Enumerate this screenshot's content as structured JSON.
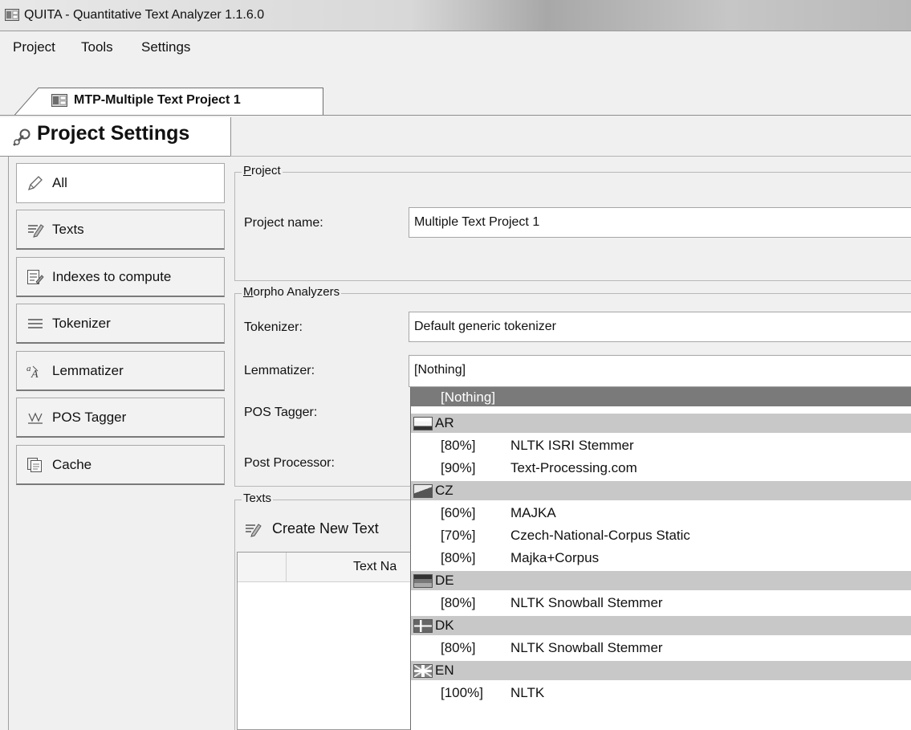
{
  "window": {
    "title": "QUITA - Quantitative Text Analyzer 1.1.6.0"
  },
  "menu": {
    "items": [
      "Project",
      "Tools",
      "Settings"
    ]
  },
  "document_tab": {
    "label": "MTP-Multiple Text Project 1"
  },
  "settings": {
    "title": "Project Settings"
  },
  "sidebar": {
    "items": [
      {
        "label": "All",
        "icon": "pencil-icon"
      },
      {
        "label": "Texts",
        "icon": "text-icon"
      },
      {
        "label": "Indexes to compute",
        "icon": "indexes-icon"
      },
      {
        "label": "Tokenizer",
        "icon": "tokenizer-icon"
      },
      {
        "label": "Lemmatizer",
        "icon": "lemmatizer-icon"
      },
      {
        "label": "POS Tagger",
        "icon": "pos-tagger-icon"
      },
      {
        "label": "Cache",
        "icon": "cache-icon"
      }
    ],
    "active_index": 0
  },
  "project_group": {
    "label": "Project",
    "name_label": "Project name:",
    "name_value": "Multiple Text Project 1"
  },
  "morpho_group": {
    "label": "Morpho Analyzers",
    "tokenizer_label": "Tokenizer:",
    "tokenizer_value": "Default generic tokenizer",
    "lemmatizer_label": "Lemmatizer:",
    "lemmatizer_value": "[Nothing]",
    "pos_label": "POS Tagger:",
    "post_label": "Post Processor:"
  },
  "texts_group": {
    "label": "Texts",
    "create_button": "Create New Text",
    "column_header": "Text Na"
  },
  "dropdown": {
    "selected": "[Nothing]",
    "groups": [
      {
        "code": "AR",
        "flag": "flag-ar-icon",
        "items": [
          {
            "pct": "[80%]",
            "name": "NLTK ISRI Stemmer"
          },
          {
            "pct": "[90%]",
            "name": "Text-Processing.com"
          }
        ]
      },
      {
        "code": "CZ",
        "flag": "flag-cz-icon",
        "items": [
          {
            "pct": "[60%]",
            "name": "MAJKA"
          },
          {
            "pct": "[70%]",
            "name": "Czech-National-Corpus Static"
          },
          {
            "pct": "[80%]",
            "name": "Majka+Corpus"
          }
        ]
      },
      {
        "code": "DE",
        "flag": "flag-de-icon",
        "items": [
          {
            "pct": "[80%]",
            "name": "NLTK Snowball Stemmer"
          }
        ]
      },
      {
        "code": "DK",
        "flag": "flag-dk-icon",
        "items": [
          {
            "pct": "[80%]",
            "name": "NLTK Snowball Stemmer"
          }
        ]
      },
      {
        "code": "EN",
        "flag": "flag-en-icon",
        "items": [
          {
            "pct": "[100%]",
            "name": "NLTK"
          }
        ]
      }
    ]
  }
}
